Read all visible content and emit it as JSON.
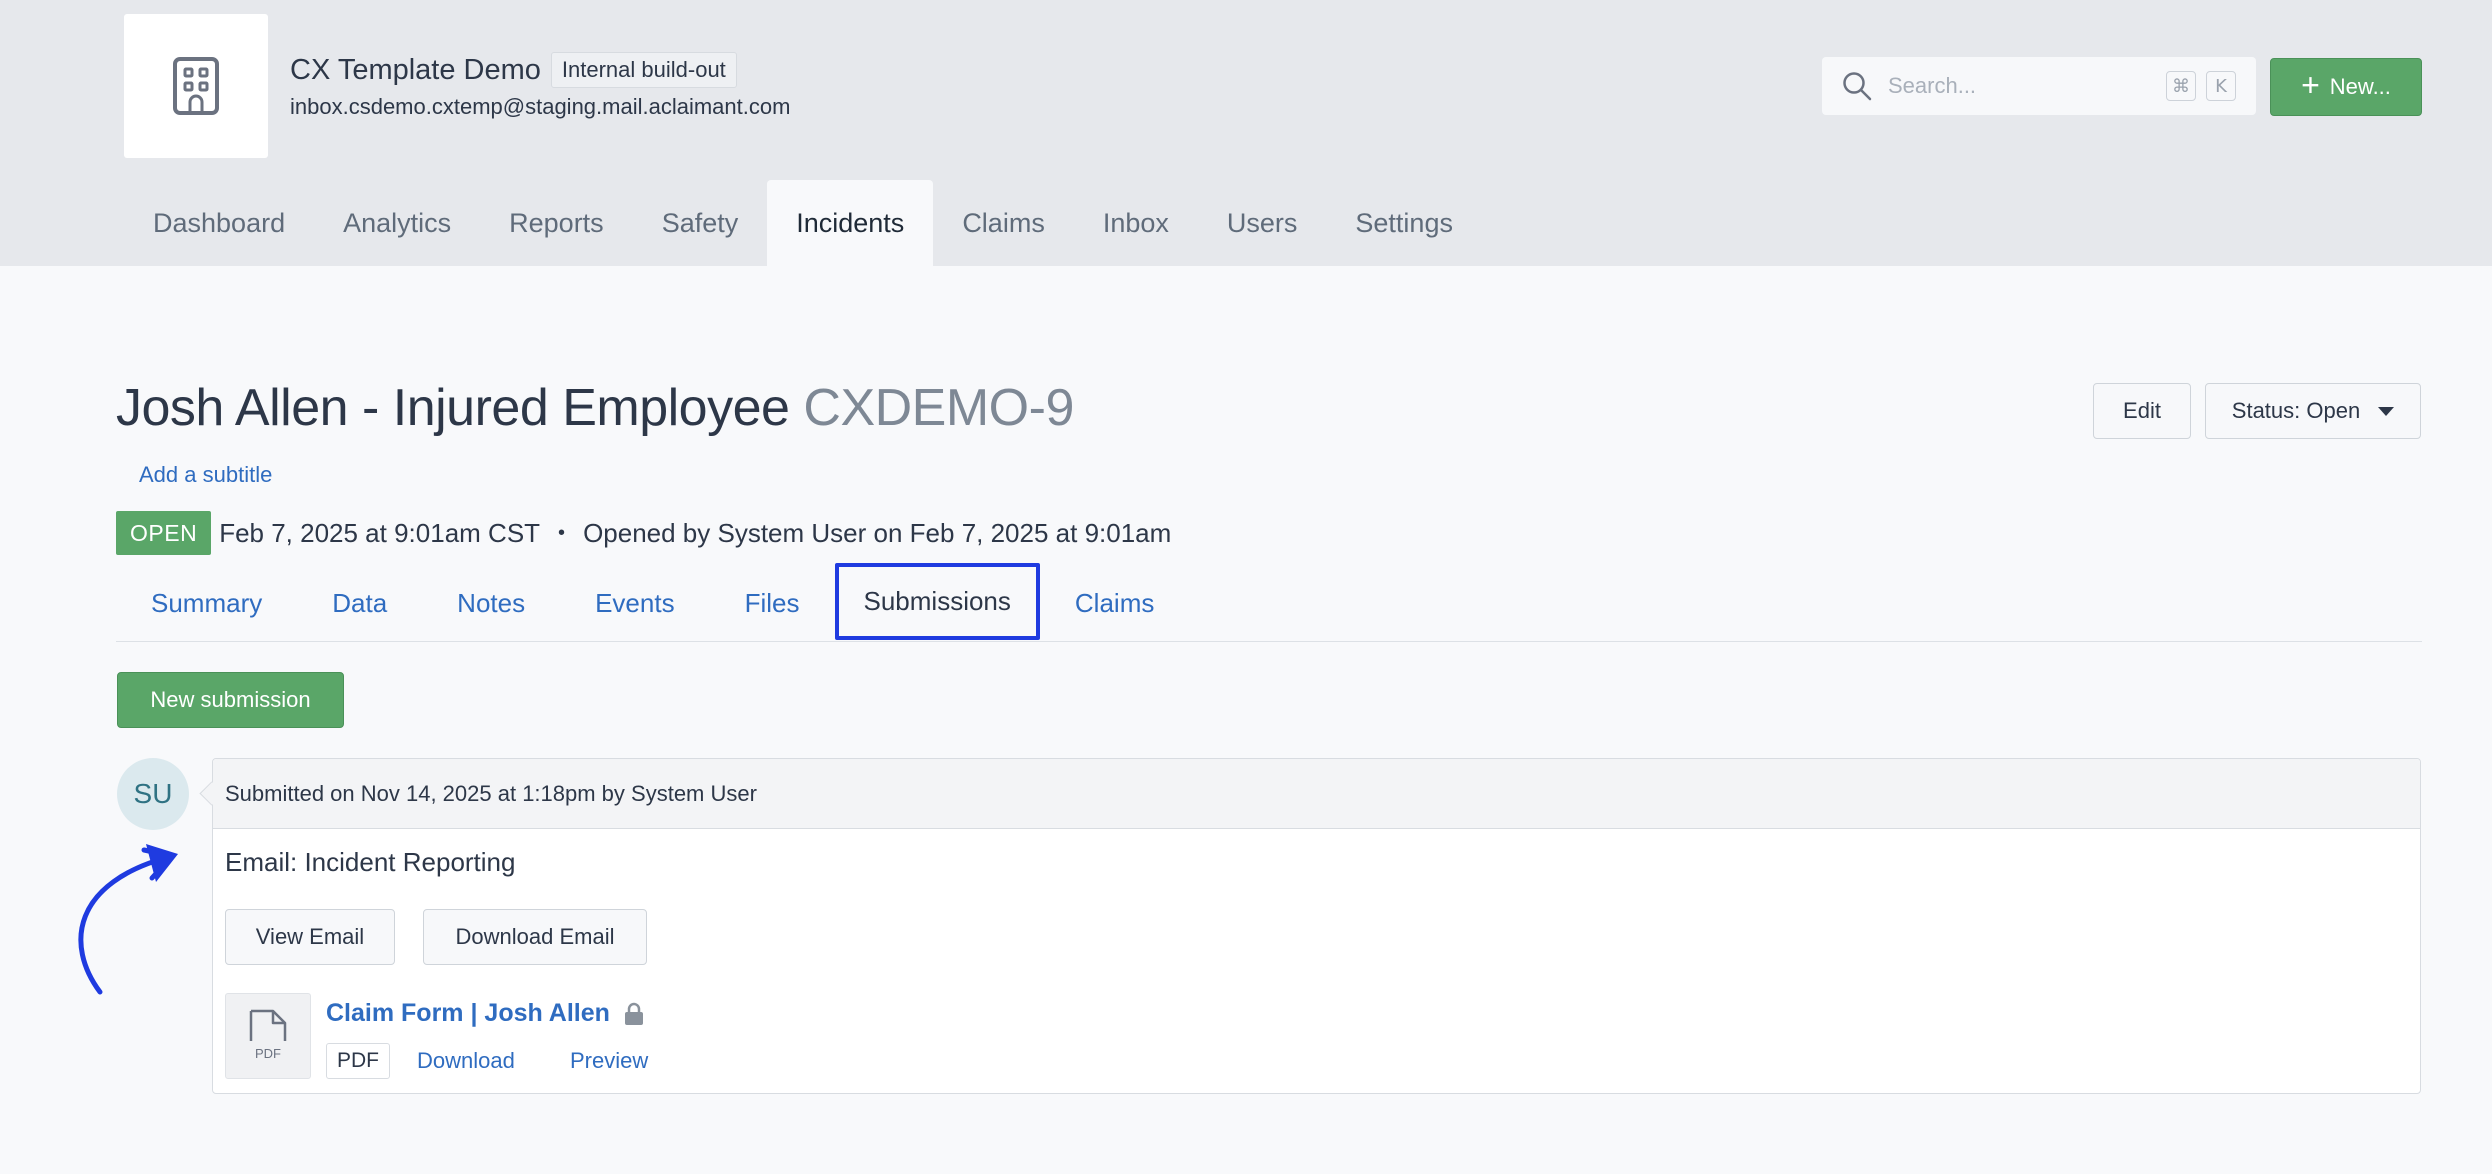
{
  "header": {
    "org_name": "CX Template Demo",
    "org_badge": "Internal build-out",
    "org_email": "inbox.csdemo.cxtemp@staging.mail.aclaimant.com",
    "search": {
      "placeholder": "Search...",
      "shortcut_keys": [
        "⌘",
        "K"
      ]
    },
    "new_button_label": "New...",
    "nav": [
      {
        "label": "Dashboard"
      },
      {
        "label": "Analytics"
      },
      {
        "label": "Reports"
      },
      {
        "label": "Safety"
      },
      {
        "label": "Incidents",
        "active": true
      },
      {
        "label": "Claims"
      },
      {
        "label": "Inbox"
      },
      {
        "label": "Users"
      },
      {
        "label": "Settings"
      }
    ]
  },
  "incident": {
    "title": "Josh Allen - Injured Employee",
    "code": "CXDEMO-9",
    "add_subtitle_label": "Add a subtitle",
    "status_badge": "OPEN",
    "date_text": "Feb 7, 2025 at 9:01am CST",
    "separator": "•",
    "opened_by_text": "Opened by System User on Feb 7, 2025 at 9:01am",
    "edit_label": "Edit",
    "status_button_label": "Status: Open"
  },
  "tabs": [
    {
      "label": "Summary"
    },
    {
      "label": "Data"
    },
    {
      "label": "Notes"
    },
    {
      "label": "Events"
    },
    {
      "label": "Files"
    },
    {
      "label": "Submissions",
      "active": true
    },
    {
      "label": "Claims"
    }
  ],
  "submissions": {
    "new_submission_label": "New submission",
    "items": [
      {
        "avatar_initials": "SU",
        "header_text": "Submitted on Nov 14, 2025 at 1:18pm by System User",
        "email_subject": "Email: Incident Reporting",
        "view_email_label": "View Email",
        "download_email_label": "Download Email",
        "file": {
          "icon_text": "PDF",
          "name": "Claim Form | Josh Allen",
          "type": "PDF",
          "download_label": "Download",
          "preview_label": "Preview"
        }
      }
    ]
  },
  "colors": {
    "accent_green": "#5aa668",
    "link_blue": "#2f6cc0",
    "highlight_blue": "#1f3be0",
    "header_bg": "#e6e8ec"
  },
  "icons": {
    "logo": "building-icon",
    "search": "search-icon",
    "new": "plus-icon",
    "status": "caret-down-icon",
    "file": "pdf-file-icon",
    "lock": "lock-icon",
    "annotation": "curved-arrow-icon"
  }
}
